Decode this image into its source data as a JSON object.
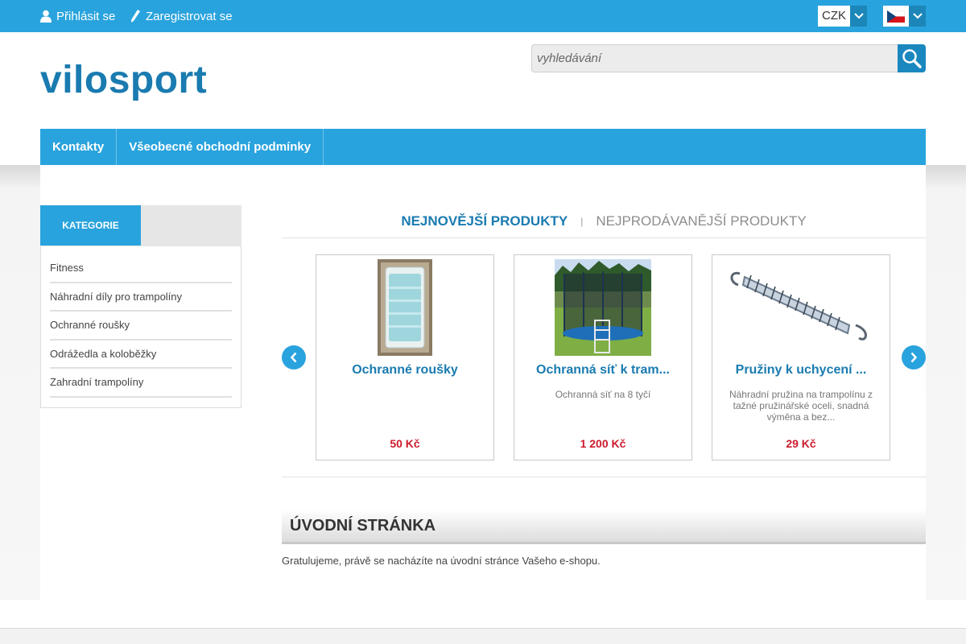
{
  "topbar": {
    "login_label": "Přihlásit se",
    "register_label": "Zaregistrovat se",
    "currency": "CZK",
    "language_flag": "czech-flag-icon"
  },
  "header": {
    "logo": "vilosport",
    "search_placeholder": "vyhledávání"
  },
  "nav": {
    "items": [
      {
        "label": "Kontakty"
      },
      {
        "label": "Všeobecné obchodní podmínky"
      }
    ]
  },
  "sidebar": {
    "tab_label": "KATEGORIE",
    "categories": [
      {
        "label": "Fitness"
      },
      {
        "label": "Náhradní díly pro trampolíny"
      },
      {
        "label": "Ochranné roušky"
      },
      {
        "label": "Odrážedla a koloběžky"
      },
      {
        "label": "Zahradní trampolíny"
      }
    ]
  },
  "product_tabs": {
    "newest": "NEJNOVĚJŠÍ PRODUKTY",
    "separator": "|",
    "bestselling": "NEJPRODÁVANĚJŠÍ PRODUKTY"
  },
  "products": [
    {
      "name": "Ochranné roušky",
      "description": "",
      "price": "50 Kč",
      "image": "face-mask-pack-image"
    },
    {
      "name": "Ochranná síť k tram...",
      "description": "Ochranná síť na 8 tyčí",
      "price": "1 200 Kč",
      "image": "trampoline-net-image"
    },
    {
      "name": "Pružiny k uchycení ...",
      "description": "Náhradní pružina na trampolínu z tažné pružinářské oceli, snadná výměna a bez...",
      "price": "29 Kč",
      "image": "spring-image"
    }
  ],
  "home": {
    "title": "ÚVODNÍ STRÁNKA",
    "text": "Gratulujeme, právě se nacházíte na úvodní stránce Vašeho e-shopu."
  },
  "colors": {
    "accent": "#29a3dd",
    "logo": "#1a7bb0",
    "price": "#cc1b2c"
  }
}
